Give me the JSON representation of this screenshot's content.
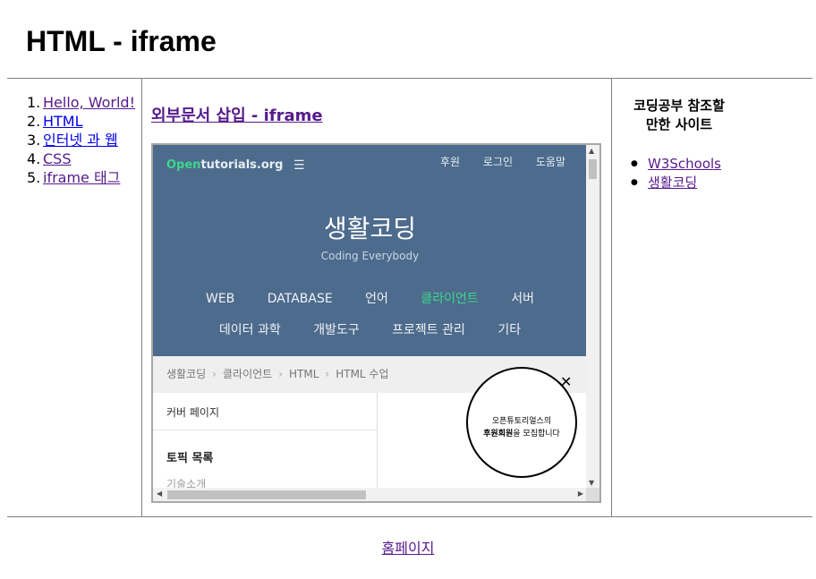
{
  "page": {
    "title": "HTML - iframe"
  },
  "nav": {
    "items": [
      {
        "num": "1.",
        "label": "Hello, World!"
      },
      {
        "num": "2.",
        "label": "HTML"
      },
      {
        "num": "3.",
        "label": "인터넷 과 웹"
      },
      {
        "num": "4.",
        "label": "CSS"
      },
      {
        "num": "5.",
        "label": "iframe 태그"
      }
    ]
  },
  "main": {
    "heading": "외부문서 삽입 - iframe"
  },
  "iframe": {
    "logo_open": "Open",
    "logo_rest": "tutorials.org",
    "menu_icon": "☰",
    "top_links": [
      "후원",
      "로그인",
      "도움말"
    ],
    "title": "생활코딩",
    "subtitle": "Coding Everybody",
    "categories_row1": [
      "WEB",
      "DATABASE",
      "언어",
      "클라이언트",
      "서버"
    ],
    "categories_row2": [
      "데이터 과학",
      "개발도구",
      "프로젝트 관리",
      "기타"
    ],
    "breadcrumb": [
      "생활코딩",
      "클라이언트",
      "HTML",
      "HTML 수업"
    ],
    "breadcrumb_sep": "›",
    "cover": "커버 페이지",
    "topics": "토픽 목록",
    "tech": "기술소개",
    "popup_line1": "오픈튜토리얼스의",
    "popup_line2_bold": "후원회원",
    "popup_line2_rest": "을 모집합니다",
    "close": "✕",
    "active_category_color": "#3dd68c",
    "header_color": "#4d6b8c"
  },
  "aside": {
    "title_line1": "코딩공부 참조할",
    "title_line2": "만한 사이트",
    "links": [
      "W3Schools",
      "생활코딩"
    ]
  },
  "footer": {
    "link": "홈페이지"
  }
}
